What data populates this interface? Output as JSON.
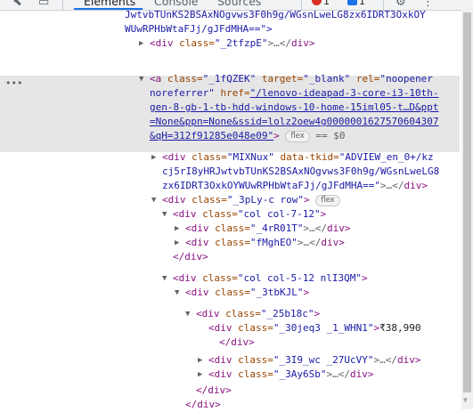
{
  "toolbar": {
    "tabs": [
      "Elements",
      "Console",
      "Sources"
    ],
    "error_count": "1",
    "message_count": "1"
  },
  "tree": {
    "l0": "JwtvbTUnKS2BSAxNOgvws3F0h9g/WGsnLweLG8zx6IDRT3OxkOY",
    "l1": "WUwRPHbWtaFJj/gJFdMHA==\">",
    "l2": {
      "tag_open": "<div",
      "attr": "class=",
      "val": "\"_2tfzpE\"",
      "ell": ">…</",
      "tag_close": "div>"
    },
    "l3": {
      "tag": "<a",
      "a1": "class=",
      "v1": "\"_1fQZEK\"",
      "a2": "target=",
      "v2": "\"_blank\"",
      "a3": "rel=",
      "v3": "\"noopener"
    },
    "l4": {
      "v": "noreferrer\"",
      "a": "href=",
      "link": "\"/lenovo-ideapad-3-core-i3-10th-"
    },
    "l5": "gen-8-gb-1-tb-hdd-windows-10-home-15iml05-t…D&ppt",
    "l6": "=None&ppn=None&ssid=lolz2oew4g0000001627570604307",
    "l7": {
      "link": "&qH=312f91285e048e09\"",
      "tag": ">",
      "flex": "flex",
      "eq": "== $0"
    },
    "l8": {
      "tag": "<div",
      "a1": "class=",
      "v1": "\"MIXNux\"",
      "a2": "data-tkid=",
      "v2": "\"ADVIEW_en_0+/kz"
    },
    "l9": "cj5rI8yHRJwtvbTUnKS2BSAxNOgvws3F0h9g/WGsnLweLG8",
    "l10": {
      "v": "zx6IDRT3OxkOYWUwRPHbWtaFJj/gJFdMHA==\"",
      "ell": ">…</",
      "tag": "div>"
    },
    "l11": {
      "tag": "<div",
      "a": "class=",
      "v": "\"_3pLy-c row\"",
      "close": ">",
      "flex": "flex"
    },
    "l12": {
      "tag": "<div",
      "a": "class=",
      "v": "\"col col-7-12\"",
      "close": ">"
    },
    "l13": {
      "tag": "<div",
      "a": "class=",
      "v": "\"_4rR01T\"",
      "ell": ">…</",
      "tag2": "div>"
    },
    "l14": {
      "tag": "<div",
      "a": "class=",
      "v": "\"fMghEO\"",
      "ell": ">…</",
      "tag2": "div>"
    },
    "l15": "</div>",
    "l16": {
      "tag": "<div",
      "a": "class=",
      "v": "\"col col-5-12 nlI3QM\"",
      "close": ">"
    },
    "l17": {
      "tag": "<div",
      "a": "class=",
      "v": "\"_3tbKJL\"",
      "close": ">"
    },
    "l18": {
      "tag": "<div",
      "a": "class=",
      "v": "\"_25b18c\"",
      "close": ">"
    },
    "l19": {
      "tag": "<div",
      "a": "class=",
      "v": "\"_30jeq3 _1_WHN1\"",
      "close": ">",
      "text": "₹38,990"
    },
    "l20": "</div>",
    "l21": {
      "tag": "<div",
      "a": "class=",
      "v": "\"_3I9_wc _27UcVY\"",
      "ell": ">…</",
      "tag2": "div>"
    },
    "l22": {
      "tag": "<div",
      "a": "class=",
      "v": "\"_3Ay6Sb\"",
      "ell": ">…</",
      "tag2": "div>"
    },
    "l23": "</div>",
    "l24": "</div>"
  }
}
